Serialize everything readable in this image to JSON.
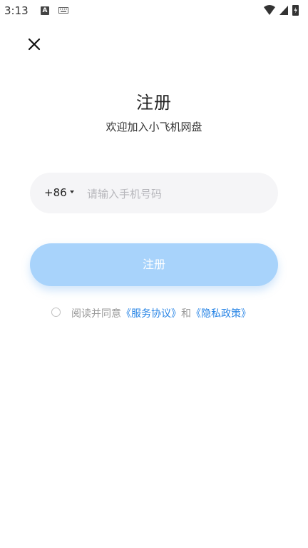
{
  "status_bar": {
    "time": "3:13",
    "a_icon_letter": "A"
  },
  "header": {
    "close_icon": "close-icon"
  },
  "page": {
    "title": "注册",
    "subtitle": "欢迎加入小飞机网盘"
  },
  "phone": {
    "country_code": "+86",
    "placeholder": "请输入手机号码",
    "value": ""
  },
  "register_button": {
    "label": "注册"
  },
  "agreement": {
    "prefix": "阅读并同意",
    "service_link": "《服务协议》",
    "conjunction": "和",
    "privacy_link": "《隐私政策》"
  },
  "colors": {
    "accent": "#2a86e6",
    "button_disabled": "#a8d3fb"
  }
}
